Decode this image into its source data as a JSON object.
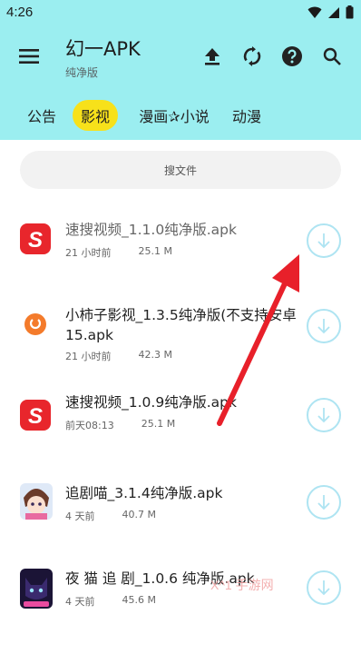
{
  "status_bar": {
    "time": "4:26"
  },
  "toolbar": {
    "title": "幻一APK",
    "subtitle": "纯净版"
  },
  "tabs": [
    {
      "label": "公告",
      "active": false
    },
    {
      "label": "影视",
      "active": true
    },
    {
      "label": "漫画✰小说",
      "active": false
    },
    {
      "label": "动漫",
      "active": false
    }
  ],
  "search": {
    "label": "搜文件"
  },
  "files": [
    {
      "name": "速搜视频_1.1.0纯净版.apk",
      "time": "21 小时前",
      "size": "25.1 M",
      "icon": "red-s-app-icon"
    },
    {
      "name": "小柿子影视_1.3.5纯净版(不支持安卓15.apk",
      "time": "21 小时前",
      "size": "42.3 M",
      "icon": "orange-persimmon-app-icon"
    },
    {
      "name": "速搜视频_1.0.9纯净版.apk",
      "time": "前天08:13",
      "size": "25.1 M",
      "icon": "red-s-app-icon"
    },
    {
      "name": "追剧喵_3.1.4纯净版.apk",
      "time": "4 天前",
      "size": "40.7 M",
      "icon": "anime-girl-app-icon"
    },
    {
      "name": "夜 猫 追 剧_1.0.6 纯净版.apk",
      "time": "4 天前",
      "size": "45.6 M",
      "icon": "night-cat-app-icon"
    }
  ],
  "colors": {
    "header": "#9beef0",
    "active_tab": "#f7e11a",
    "arrow": "#e8202a",
    "download_ring": "#aee4f2"
  }
}
